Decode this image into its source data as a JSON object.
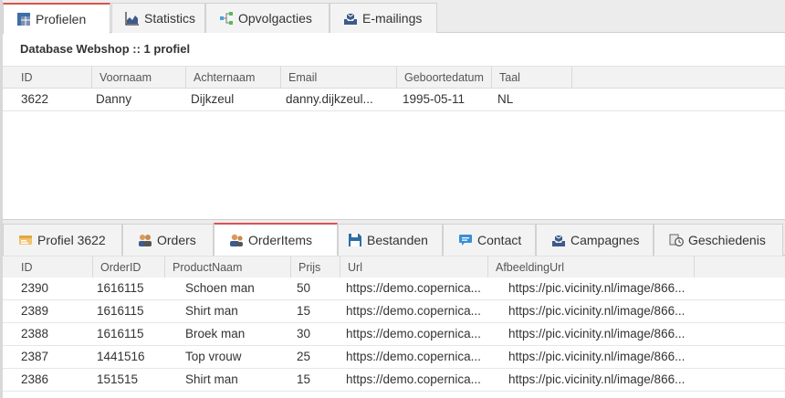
{
  "top_tabs": [
    {
      "label": "Profielen",
      "icon": "grid-icon"
    },
    {
      "label": "Statistics",
      "icon": "area-chart-icon"
    },
    {
      "label": "Opvolgacties",
      "icon": "flow-icon"
    },
    {
      "label": "E-mailings",
      "icon": "mail-tray-icon"
    }
  ],
  "subtitle": "Database Webshop :: 1 profiel",
  "profiles": {
    "columns": [
      "ID",
      "Voornaam",
      "Achternaam",
      "Email",
      "Geboortedatum",
      "Taal"
    ],
    "rows": [
      [
        "3622",
        "Danny",
        "Dijkzeul",
        "danny.dijkzeul...",
        "1995-05-11",
        "NL"
      ]
    ]
  },
  "bottom_tabs": [
    {
      "label": "Profiel 3622",
      "icon": "card-icon"
    },
    {
      "label": "Orders",
      "icon": "users-icon"
    },
    {
      "label": "OrderItems",
      "icon": "user-icon"
    },
    {
      "label": "Bestanden",
      "icon": "save-icon"
    },
    {
      "label": "Contact",
      "icon": "chat-icon"
    },
    {
      "label": "Campagnes",
      "icon": "mail-tray-icon"
    },
    {
      "label": "Geschiedenis",
      "icon": "history-icon"
    }
  ],
  "order_items": {
    "columns": [
      "ID",
      "OrderID",
      "ProductNaam",
      "Prijs",
      "Url",
      "AfbeeldingUrl"
    ],
    "rows": [
      [
        "2390",
        "1616115",
        "Schoen man",
        "50",
        "https://demo.copernica...",
        "https://pic.vicinity.nl/image/866..."
      ],
      [
        "2389",
        "1616115",
        "Shirt man",
        "15",
        "https://demo.copernica...",
        "https://pic.vicinity.nl/image/866..."
      ],
      [
        "2388",
        "1616115",
        "Broek man",
        "30",
        "https://demo.copernica...",
        "https://pic.vicinity.nl/image/866..."
      ],
      [
        "2387",
        "1441516",
        "Top vrouw",
        "25",
        "https://demo.copernica...",
        "https://pic.vicinity.nl/image/866..."
      ],
      [
        "2386",
        "151515",
        "Shirt man",
        "15",
        "https://demo.copernica...",
        "https://pic.vicinity.nl/image/866..."
      ]
    ]
  },
  "colors": {
    "active_tab_accent": "#d9534f",
    "icon_blue": "#3d6ea8"
  }
}
